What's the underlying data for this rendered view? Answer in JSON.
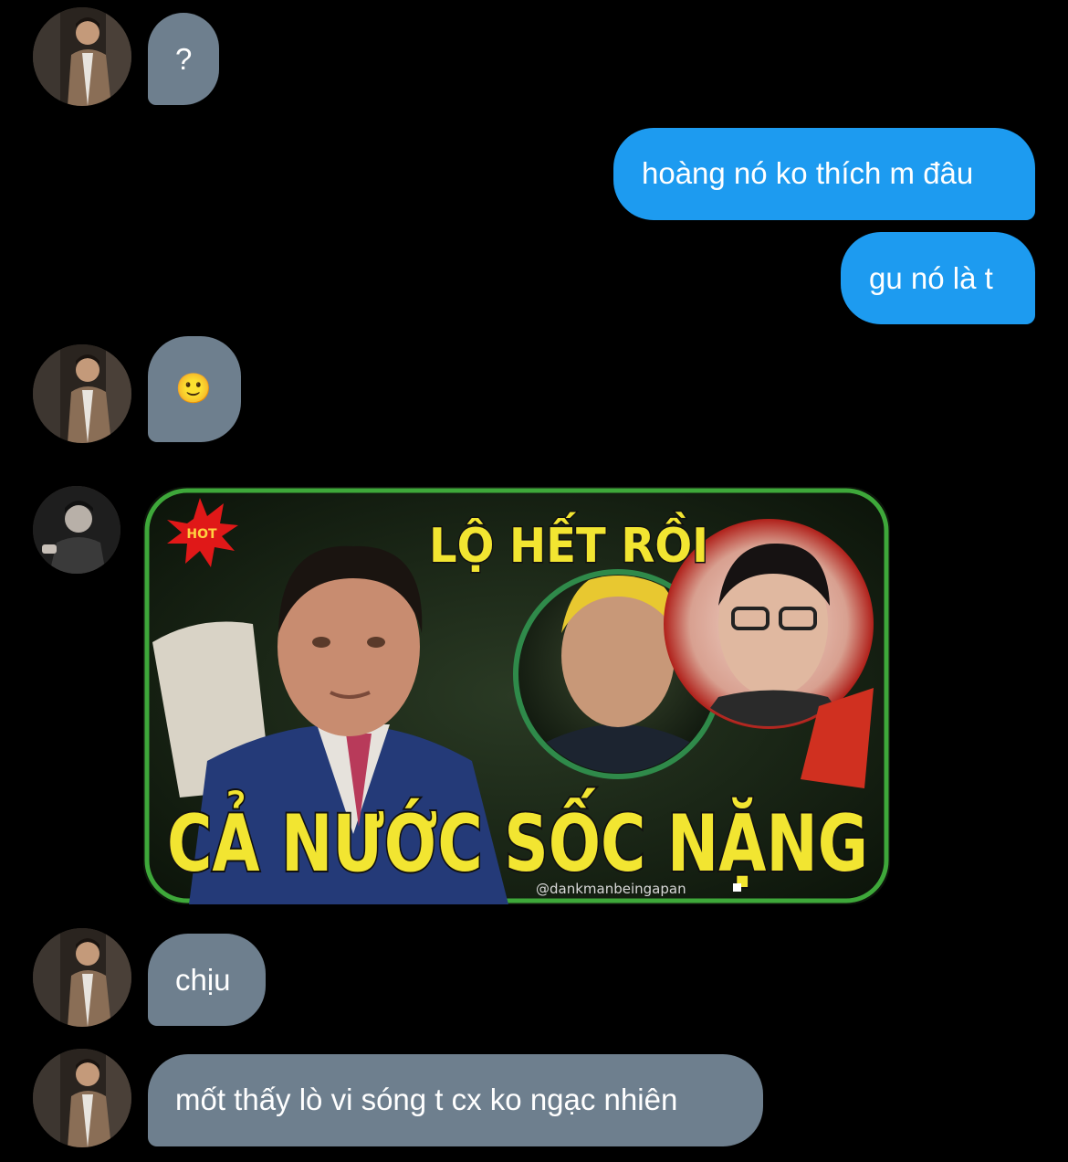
{
  "messages": [
    {
      "id": "m1",
      "side": "in",
      "text": "?"
    },
    {
      "id": "m2",
      "side": "out",
      "text": "hoàng nó ko thích m đâu"
    },
    {
      "id": "m3",
      "side": "out",
      "text": "gu nó là t"
    },
    {
      "id": "m4",
      "side": "in",
      "text": "🙂"
    },
    {
      "id": "m5",
      "side": "in",
      "type": "image",
      "image": {
        "top_text": "LỘ HẾT RỒI",
        "bottom_text": "CẢ NƯỚC SỐC NẶNG",
        "badge_text": "HOT",
        "watermark": "@dankmanbeingapan"
      }
    },
    {
      "id": "m6",
      "side": "in",
      "text": "chịu"
    },
    {
      "id": "m7",
      "side": "in",
      "text": "mốt thấy lò vi sóng t cx ko ngạc nhiên"
    }
  ],
  "colors": {
    "background": "#000000",
    "incoming_bubble": "#6e7f8e",
    "outgoing_bubble": "#1d9bf0",
    "headline_yellow": "#f2e531",
    "text": "#ffffff"
  },
  "icons": {
    "avatar": "contact-avatar-photo",
    "badge": "hot-burst-badge",
    "watermark_logo": "tiktok-logo"
  }
}
